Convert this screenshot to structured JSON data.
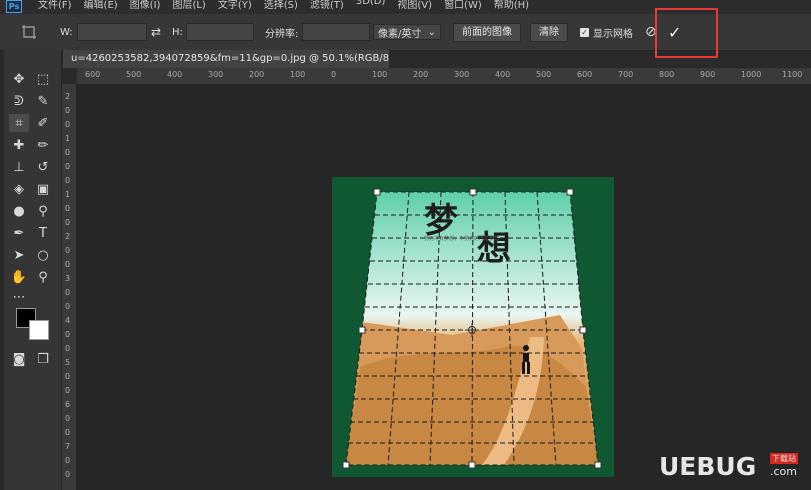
{
  "app": {
    "logo_text": "Ps"
  },
  "menu": [
    "文件(F)",
    "编辑(E)",
    "图像(I)",
    "图层(L)",
    "文字(Y)",
    "选择(S)",
    "滤镜(T)",
    "3D(D)",
    "视图(V)",
    "窗口(W)",
    "帮助(H)"
  ],
  "options": {
    "width_label": "W:",
    "height_label": "H:",
    "resolution_label": "分辨率:",
    "unit_select": "像素/英寸",
    "front_image_button": "前面的图像",
    "clear_button": "清除",
    "show_grid_label": "显示网格",
    "commit_glyph": "✓",
    "cancel_glyph": "⊘"
  },
  "document": {
    "tab_label": "u=4260253582,394072859&fm=11&gp=0.jpg @ 50.1%(RGB/8#)",
    "close_glyph": "×"
  },
  "ruler": {
    "top_ticks": [
      "600",
      "500",
      "400",
      "300",
      "200",
      "100",
      "0",
      "100",
      "200",
      "300",
      "400",
      "500",
      "600",
      "700",
      "800",
      "900",
      "1000",
      "1100"
    ],
    "left_ticks": [
      "2",
      "0",
      "0",
      "1",
      "0",
      "0",
      "0",
      "1",
      "0",
      "0",
      "2",
      "0",
      "0",
      "3",
      "0",
      "0",
      "4",
      "0",
      "0",
      "5",
      "0",
      "0",
      "6",
      "0",
      "0",
      "7",
      "0",
      "0"
    ]
  },
  "poster": {
    "title_chars": [
      "梦",
      "想"
    ],
    "tiny_text": "努力才有梦想，不努力的才是梦想"
  },
  "watermark": {
    "main": "UEBUG",
    "sub": "下载站",
    "com": ".com"
  },
  "colors": {
    "highlight": "#e63b35",
    "canvas_green": "#0f5832",
    "foreground": "#000000",
    "background": "#ffffff"
  }
}
